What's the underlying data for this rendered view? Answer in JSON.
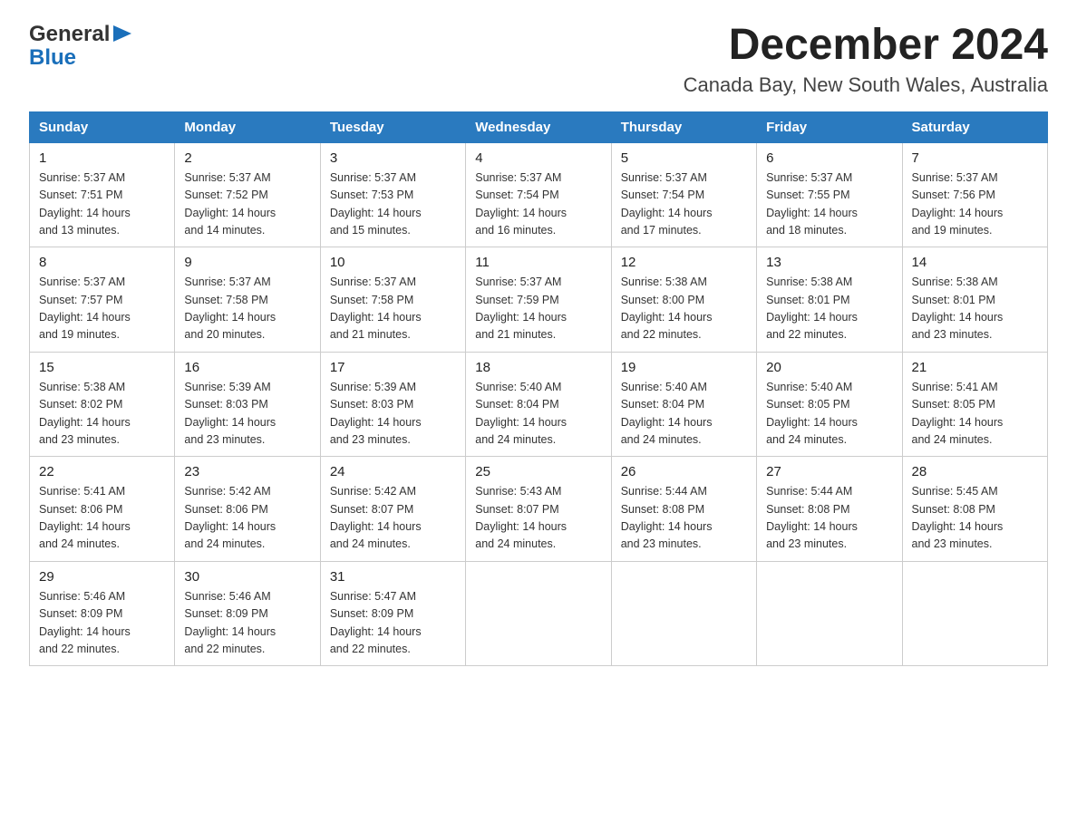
{
  "header": {
    "logo_general": "General",
    "logo_blue": "Blue",
    "month_year": "December 2024",
    "location": "Canada Bay, New South Wales, Australia"
  },
  "weekdays": [
    "Sunday",
    "Monday",
    "Tuesday",
    "Wednesday",
    "Thursday",
    "Friday",
    "Saturday"
  ],
  "weeks": [
    [
      {
        "day": "1",
        "sunrise": "5:37 AM",
        "sunset": "7:51 PM",
        "daylight": "14 hours and 13 minutes."
      },
      {
        "day": "2",
        "sunrise": "5:37 AM",
        "sunset": "7:52 PM",
        "daylight": "14 hours and 14 minutes."
      },
      {
        "day": "3",
        "sunrise": "5:37 AM",
        "sunset": "7:53 PM",
        "daylight": "14 hours and 15 minutes."
      },
      {
        "day": "4",
        "sunrise": "5:37 AM",
        "sunset": "7:54 PM",
        "daylight": "14 hours and 16 minutes."
      },
      {
        "day": "5",
        "sunrise": "5:37 AM",
        "sunset": "7:54 PM",
        "daylight": "14 hours and 17 minutes."
      },
      {
        "day": "6",
        "sunrise": "5:37 AM",
        "sunset": "7:55 PM",
        "daylight": "14 hours and 18 minutes."
      },
      {
        "day": "7",
        "sunrise": "5:37 AM",
        "sunset": "7:56 PM",
        "daylight": "14 hours and 19 minutes."
      }
    ],
    [
      {
        "day": "8",
        "sunrise": "5:37 AM",
        "sunset": "7:57 PM",
        "daylight": "14 hours and 19 minutes."
      },
      {
        "day": "9",
        "sunrise": "5:37 AM",
        "sunset": "7:58 PM",
        "daylight": "14 hours and 20 minutes."
      },
      {
        "day": "10",
        "sunrise": "5:37 AM",
        "sunset": "7:58 PM",
        "daylight": "14 hours and 21 minutes."
      },
      {
        "day": "11",
        "sunrise": "5:37 AM",
        "sunset": "7:59 PM",
        "daylight": "14 hours and 21 minutes."
      },
      {
        "day": "12",
        "sunrise": "5:38 AM",
        "sunset": "8:00 PM",
        "daylight": "14 hours and 22 minutes."
      },
      {
        "day": "13",
        "sunrise": "5:38 AM",
        "sunset": "8:01 PM",
        "daylight": "14 hours and 22 minutes."
      },
      {
        "day": "14",
        "sunrise": "5:38 AM",
        "sunset": "8:01 PM",
        "daylight": "14 hours and 23 minutes."
      }
    ],
    [
      {
        "day": "15",
        "sunrise": "5:38 AM",
        "sunset": "8:02 PM",
        "daylight": "14 hours and 23 minutes."
      },
      {
        "day": "16",
        "sunrise": "5:39 AM",
        "sunset": "8:03 PM",
        "daylight": "14 hours and 23 minutes."
      },
      {
        "day": "17",
        "sunrise": "5:39 AM",
        "sunset": "8:03 PM",
        "daylight": "14 hours and 23 minutes."
      },
      {
        "day": "18",
        "sunrise": "5:40 AM",
        "sunset": "8:04 PM",
        "daylight": "14 hours and 24 minutes."
      },
      {
        "day": "19",
        "sunrise": "5:40 AM",
        "sunset": "8:04 PM",
        "daylight": "14 hours and 24 minutes."
      },
      {
        "day": "20",
        "sunrise": "5:40 AM",
        "sunset": "8:05 PM",
        "daylight": "14 hours and 24 minutes."
      },
      {
        "day": "21",
        "sunrise": "5:41 AM",
        "sunset": "8:05 PM",
        "daylight": "14 hours and 24 minutes."
      }
    ],
    [
      {
        "day": "22",
        "sunrise": "5:41 AM",
        "sunset": "8:06 PM",
        "daylight": "14 hours and 24 minutes."
      },
      {
        "day": "23",
        "sunrise": "5:42 AM",
        "sunset": "8:06 PM",
        "daylight": "14 hours and 24 minutes."
      },
      {
        "day": "24",
        "sunrise": "5:42 AM",
        "sunset": "8:07 PM",
        "daylight": "14 hours and 24 minutes."
      },
      {
        "day": "25",
        "sunrise": "5:43 AM",
        "sunset": "8:07 PM",
        "daylight": "14 hours and 24 minutes."
      },
      {
        "day": "26",
        "sunrise": "5:44 AM",
        "sunset": "8:08 PM",
        "daylight": "14 hours and 23 minutes."
      },
      {
        "day": "27",
        "sunrise": "5:44 AM",
        "sunset": "8:08 PM",
        "daylight": "14 hours and 23 minutes."
      },
      {
        "day": "28",
        "sunrise": "5:45 AM",
        "sunset": "8:08 PM",
        "daylight": "14 hours and 23 minutes."
      }
    ],
    [
      {
        "day": "29",
        "sunrise": "5:46 AM",
        "sunset": "8:09 PM",
        "daylight": "14 hours and 22 minutes."
      },
      {
        "day": "30",
        "sunrise": "5:46 AM",
        "sunset": "8:09 PM",
        "daylight": "14 hours and 22 minutes."
      },
      {
        "day": "31",
        "sunrise": "5:47 AM",
        "sunset": "8:09 PM",
        "daylight": "14 hours and 22 minutes."
      },
      null,
      null,
      null,
      null
    ]
  ],
  "labels": {
    "sunrise": "Sunrise:",
    "sunset": "Sunset:",
    "daylight": "Daylight:"
  }
}
